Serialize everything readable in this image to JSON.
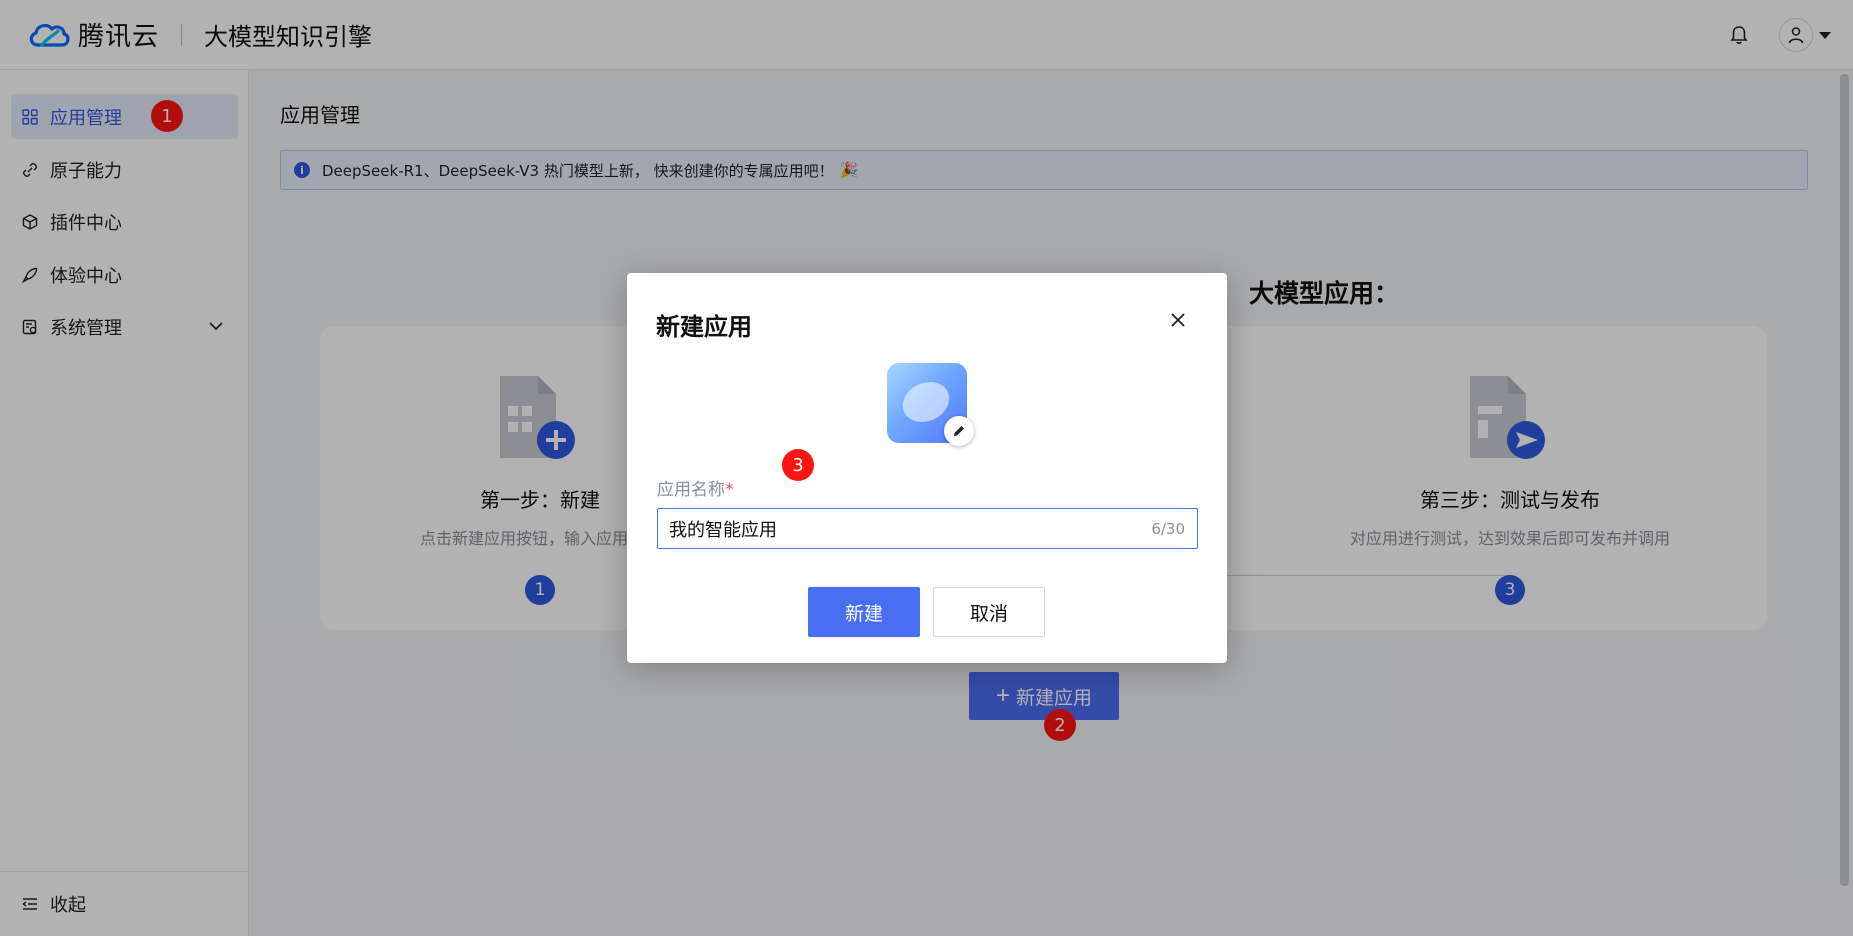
{
  "header": {
    "brand": "腾讯云",
    "product": "大模型知识引擎"
  },
  "sidebar": {
    "items": [
      {
        "label": "应用管理",
        "icon": "grid-icon",
        "active": true
      },
      {
        "label": "原子能力",
        "icon": "link-icon"
      },
      {
        "label": "插件中心",
        "icon": "cube-icon"
      },
      {
        "label": "体验中心",
        "icon": "rocket-icon"
      },
      {
        "label": "系统管理",
        "icon": "settings-file-icon",
        "expandable": true
      }
    ],
    "collapse_label": "收起"
  },
  "main": {
    "page_title": "应用管理",
    "notice": "DeepSeek-R1、DeepSeek-V3 热门模型上新， 快来创建你的专属应用吧！",
    "notice_emoji": "🎉",
    "guide_title_fragment": "大模型应用：",
    "steps": [
      {
        "title": "第一步：新建",
        "desc": "点击新建应用按钮，输入应用名称",
        "number": "1"
      },
      {
        "title": "第三步：测试与发布",
        "desc": "对应用进行测试，达到效果后即可发布并调用",
        "number": "3"
      }
    ],
    "new_app_button": "新建应用"
  },
  "annotations": {
    "badge1": "1",
    "badge2": "2",
    "badge3": "3"
  },
  "modal": {
    "title": "新建应用",
    "field_label": "应用名称",
    "field_required_mark": "*",
    "field_value": "我的智能应用",
    "field_counter": "6/30",
    "confirm_button": "新建",
    "cancel_button": "取消"
  },
  "colors": {
    "primary": "#4a6ef2",
    "badge_red": "#ff1414",
    "active_bg": "#e5ebfa"
  }
}
